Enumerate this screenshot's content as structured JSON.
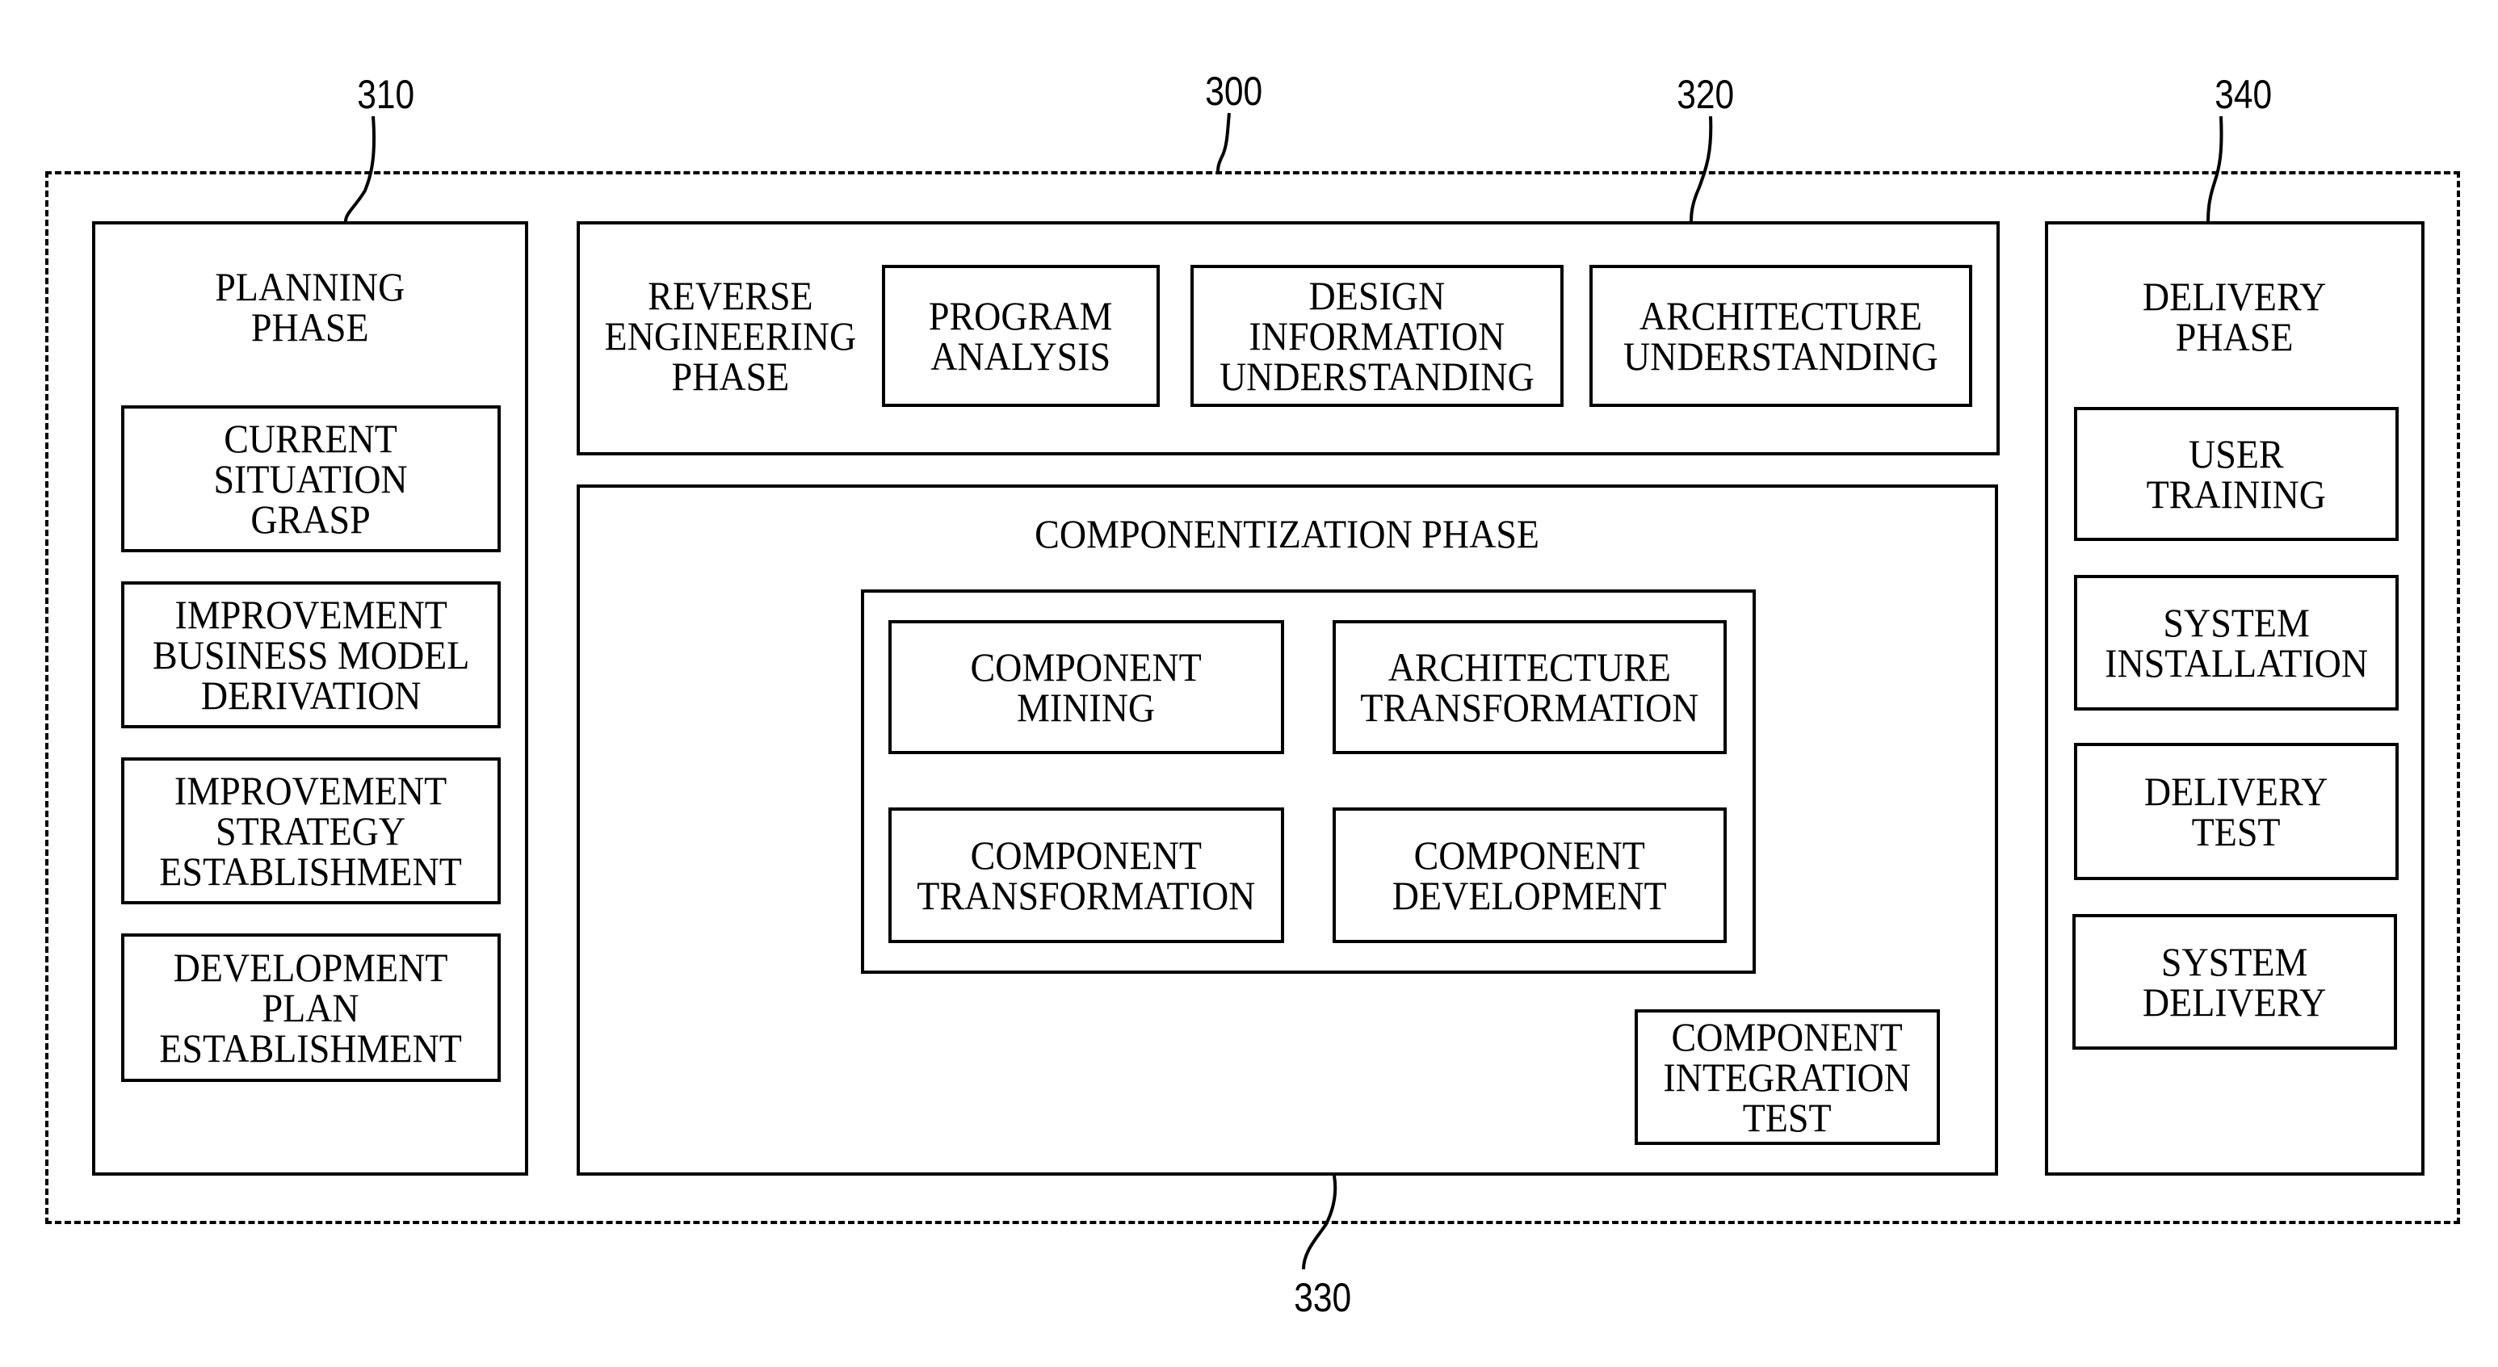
{
  "figure": {
    "reference_numerals": {
      "overall": "300",
      "planning": "310",
      "reverse_engineering": "320",
      "componentization": "330",
      "delivery": "340"
    },
    "planning_phase": {
      "title": "PLANNING\nPHASE",
      "steps": [
        "CURRENT\nSITUATION\nGRASP",
        "IMPROVEMENT\nBUSINESS MODEL\nDERIVATION",
        "IMPROVEMENT\nSTRATEGY\nESTABLISHMENT",
        "DEVELOPMENT\nPLAN\nESTABLISHMENT"
      ]
    },
    "reverse_engineering_phase": {
      "title": "REVERSE\nENGINEERING\nPHASE",
      "steps": [
        "PROGRAM\nANALYSIS",
        "DESIGN\nINFORMATION\nUNDERSTANDING",
        "ARCHITECTURE\nUNDERSTANDING"
      ]
    },
    "componentization_phase": {
      "title": "COMPONENTIZATION PHASE",
      "grid_steps": [
        "COMPONENT\nMINING",
        "ARCHITECTURE\nTRANSFORMATION",
        "COMPONENT\nTRANSFORMATION",
        "COMPONENT\nDEVELOPMENT"
      ],
      "integration_step": "COMPONENT\nINTEGRATION\nTEST"
    },
    "delivery_phase": {
      "title": "DELIVERY\nPHASE",
      "steps": [
        "USER\nTRAINING",
        "SYSTEM\nINSTALLATION",
        "DELIVERY\nTEST",
        "SYSTEM\nDELIVERY"
      ]
    }
  }
}
